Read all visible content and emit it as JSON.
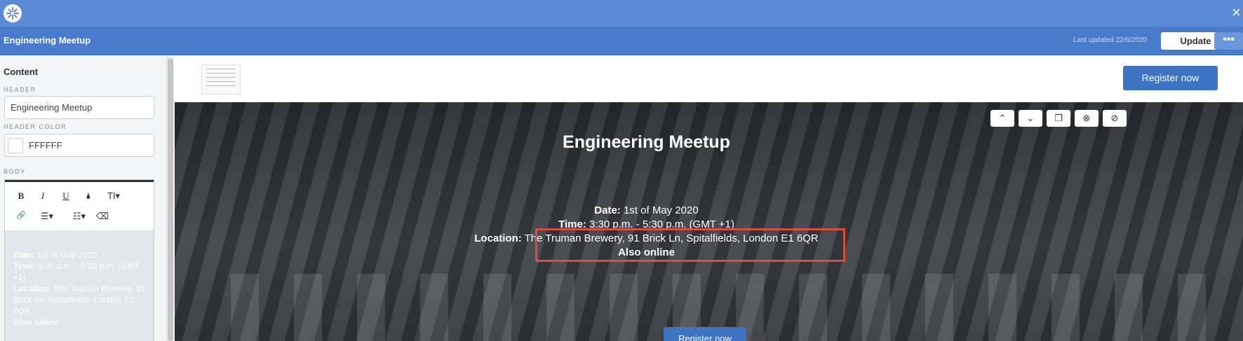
{
  "app": {
    "title": "Engineering Meetup",
    "last_updated": "Last updated 22/6/2020",
    "update_label": "Update",
    "more_label": "•••",
    "close_label": "×"
  },
  "sidebar": {
    "heading": "Content",
    "header_label": "HEADER",
    "header_value": "Engineering Meetup",
    "header_color_label": "HEADER COLOR",
    "header_color_value": "FFFFFF",
    "body_label": "BODY",
    "toolbar": {
      "bold": "B",
      "italic": "I",
      "underline": "U",
      "color": "🌢",
      "text_size": "TI▾",
      "link": "🔗",
      "bullets": "☰▾",
      "numbers": "☷▾",
      "clear": "⌫"
    },
    "body": {
      "date_label": "Date:",
      "date_value": " 1st of May 2020",
      "time_label": "Time:",
      "time_value": " 3:30 p.m. - 5:30 p.m. (GMT +1)",
      "location_label": "Location:",
      "location_value": " The Truman Brewery, 91 Brick Ln, Spitalfields, London E1 6QR",
      "online": "Also online"
    }
  },
  "preview": {
    "register_top": "Register now",
    "hero": {
      "title": "Engineering Meetup",
      "date_label": "Date:",
      "date_value": " 1st of May 2020",
      "time_label": "Time:",
      "time_value": " 3:30 p.m. - 5:30 p.m. (GMT +1)",
      "location_label": "Location:",
      "location_value": " The Truman Brewery, 91 Brick Ln, Spitalfields, London E1 6QR",
      "online": "Also online",
      "register": "Register now"
    },
    "controls": {
      "up": "⌃",
      "down": "⌄",
      "copy": "❐",
      "delete": "⊗",
      "hide": "⊘"
    }
  },
  "colors": {
    "topbar": "#5b8ad6",
    "titlebar": "#4a7bcb",
    "button": "#3f74c2",
    "highlight": "#e04a3f"
  }
}
